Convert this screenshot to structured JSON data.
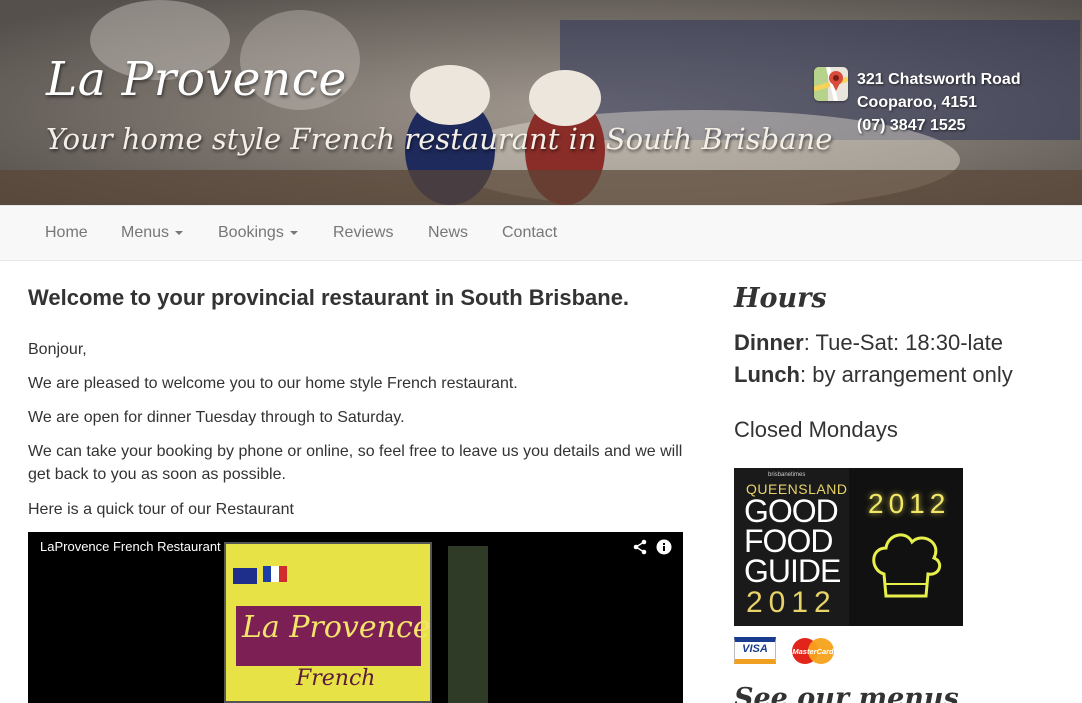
{
  "header": {
    "title": "La Provence",
    "subtitle": "Your home style French restaurant in South Brisbane",
    "address_line1": "321 Chatsworth Road",
    "address_line2": "Cooparoo, 4151",
    "phone": "(07) 3847 1525",
    "map_icon": "google-maps-icon"
  },
  "nav": {
    "home": "Home",
    "menus": "Menus",
    "bookings": "Bookings",
    "reviews": "Reviews",
    "news": "News",
    "contact": "Contact"
  },
  "main": {
    "heading": "Welcome to your provincial restaurant in South Brisbane.",
    "p1": "Bonjour,",
    "p2": "We are pleased to welcome you to our home style French restaurant.",
    "p3": "We are open for dinner Tuesday through to Saturday.",
    "p4": "We can take your booking by phone or online, so feel free to leave us you details and we will get back to you as soon as possible.",
    "p5": "Here is a quick tour of our Restaurant",
    "video": {
      "title": "LaProvence French Restaurant",
      "sign_text1": "La Provence",
      "sign_text2": "French",
      "share_icon": "share-icon",
      "info_icon": "info-icon"
    }
  },
  "sidebar": {
    "hours_heading": "Hours",
    "dinner_label": "Dinner",
    "dinner_value": ": Tue-Sat: 18:30-late",
    "lunch_label": "Lunch",
    "lunch_value": ": by arrangement only",
    "closed": "Closed Mondays",
    "award": {
      "brand": "brisbanetimes",
      "state": "QUEENSLAND",
      "line1": "GOOD",
      "line2": "FOOD",
      "line3": "GUIDE",
      "year": "2012",
      "year_right": "2012"
    },
    "cards": {
      "visa": "VISA",
      "mastercard": "MasterCard"
    },
    "see_menus": "See our menus"
  },
  "colors": {
    "navbar_bg": "#f8f8f8",
    "nav_text": "#777777",
    "text": "#333333"
  }
}
